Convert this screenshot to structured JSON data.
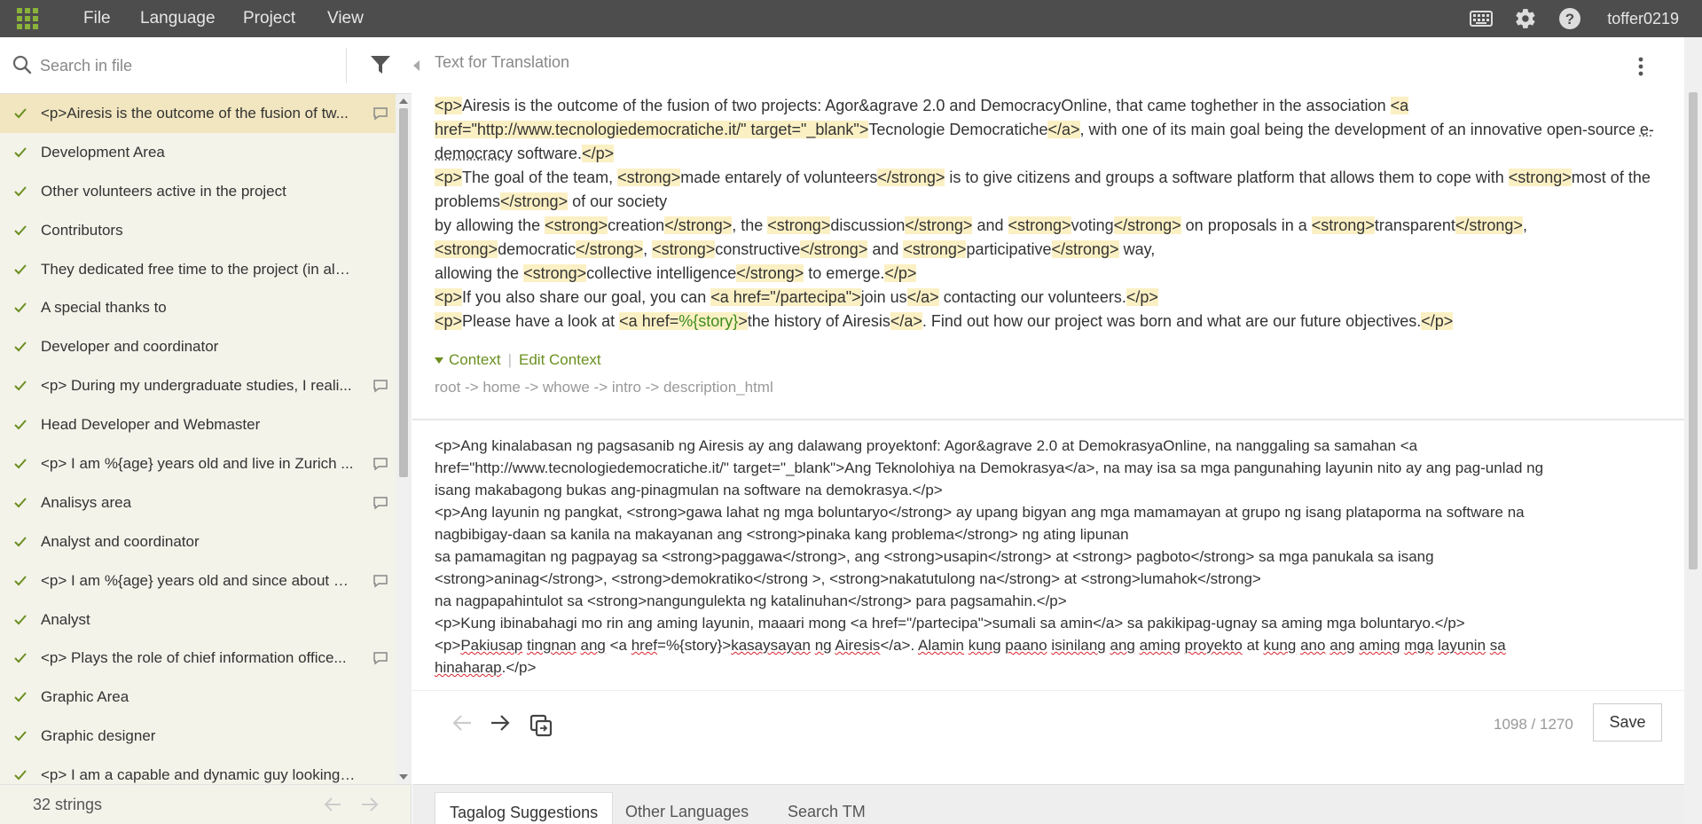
{
  "topbar": {
    "menu": [
      "File",
      "Language",
      "Project",
      "View"
    ],
    "user": "toffer0219",
    "icons": [
      "apps-grid-icon",
      "keyboard-icon",
      "gear-icon",
      "help-icon"
    ]
  },
  "sidebar": {
    "search_placeholder": "Search in file",
    "items": [
      {
        "text": "<p>Airesis is the outcome of the fusion of tw...",
        "comment": true,
        "active": true
      },
      {
        "text": "Development Area",
        "comment": false
      },
      {
        "text": "Other volunteers active in the project",
        "comment": false
      },
      {
        "text": "Contributors",
        "comment": false
      },
      {
        "text": "They dedicated free time to the project (in alpha...",
        "comment": false
      },
      {
        "text": "A special thanks to",
        "comment": false
      },
      {
        "text": "Developer and coordinator",
        "comment": false
      },
      {
        "text": "<p> During my undergraduate studies, I reali...",
        "comment": true
      },
      {
        "text": "Head Developer and Webmaster",
        "comment": false
      },
      {
        "text": "<p> I am %{age} years old and live in Zurich ...",
        "comment": true
      },
      {
        "text": "Analisys area",
        "comment": true
      },
      {
        "text": "Analyst and coordinator",
        "comment": false
      },
      {
        "text": "<p> I am %{age} years old and since about %...",
        "comment": true
      },
      {
        "text": "Analyst",
        "comment": false
      },
      {
        "text": "<p> Plays the role of chief information office...",
        "comment": true
      },
      {
        "text": "Graphic Area",
        "comment": false
      },
      {
        "text": "Graphic designer",
        "comment": false
      },
      {
        "text": "<p> I am a capable and dynamic guy looking for ...",
        "comment": false
      }
    ],
    "count": "32 strings"
  },
  "main": {
    "header": "Text for Translation",
    "context_toggle": "Context",
    "edit_context": "Edit Context",
    "breadcrumb": "root -> home -> whowe -> intro -> description_html",
    "char_count": "1098 / 1270",
    "save_label": "Save",
    "tabs": [
      "Tagalog Suggestions",
      "Other Languages",
      "Search TM"
    ]
  },
  "colors": {
    "topbar": "#4d4d4d",
    "accent_green": "#6a8f1f",
    "highlight": "#fbf0c4",
    "active_item": "#f1e6bf",
    "sidebar_bg": "#f4f3ea"
  }
}
